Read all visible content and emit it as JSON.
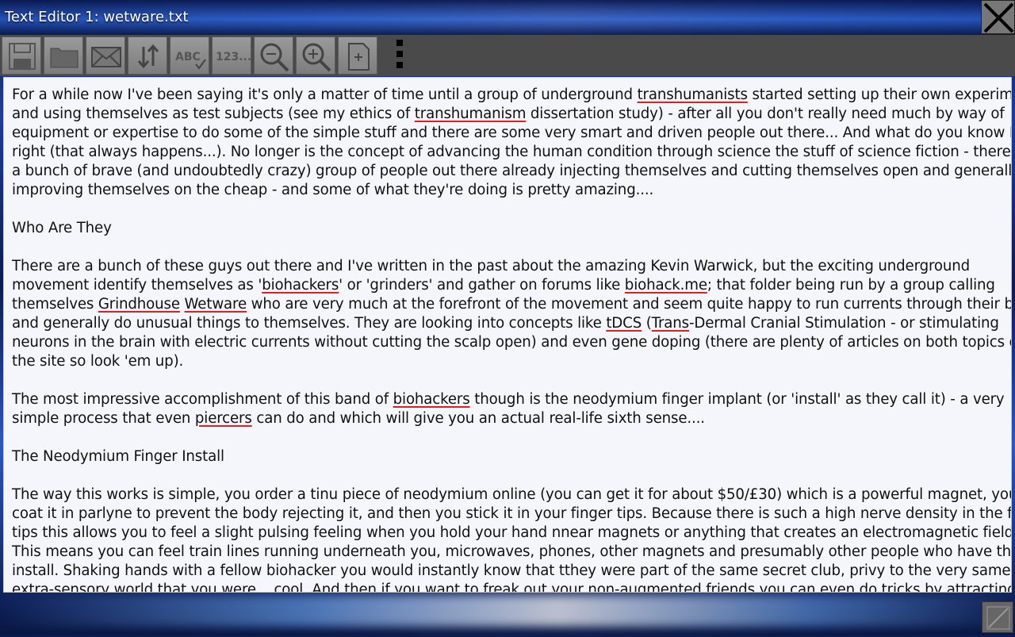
{
  "window": {
    "title": "Text Editor 1: wetware.txt"
  },
  "toolbar": {
    "buttons": [
      {
        "name": "save",
        "icon": "floppy-icon"
      },
      {
        "name": "open",
        "icon": "folder-icon"
      },
      {
        "name": "email",
        "icon": "envelope-icon"
      },
      {
        "name": "sort",
        "icon": "up-down-arrows-icon"
      },
      {
        "name": "spellcheck",
        "icon": "abc-check-icon",
        "label": "ABC"
      },
      {
        "name": "numbers",
        "icon": "123-icon",
        "label": "123..."
      },
      {
        "name": "zoom-out",
        "icon": "zoom-out-icon"
      },
      {
        "name": "zoom-in",
        "icon": "zoom-in-icon"
      },
      {
        "name": "new-document",
        "icon": "new-page-icon"
      }
    ],
    "overflow_icon": "more-vert-icon"
  },
  "document": {
    "lines": [
      "For a while now I've been saying it's only a matter of time until a group of underground |transhumanists| started setting up their own experiments",
      "and using themselves as test subjects (see my ethics of |transhumanism| dissertation study) - after all you don't really need much by way of",
      "equipment or expertise to do some of the simple stuff and there are some very smart and driven people out there... And what do you know I was",
      "right (that always happens...). No longer is the concept of advancing the human condition through science the stuff of science fiction - there are",
      "a bunch of brave (and undoubtedly crazy) group of people out there already injecting themselves and cutting themselves open and generally",
      "improving themselves on the cheap - and some of what they're doing is pretty amazing....",
      "",
      "Who Are They",
      "",
      "There are a bunch of these guys out there and I've written in the past about the amazing Kevin Warwick, but the exciting underground",
      "movement identify themselves as '|biohackers|' or 'grinders' and gather on forums like |biohack.me|; that folder being run by a group calling",
      "themselves |Grindhouse| |Wetware| who are very much at the forefront of the movement and seem quite happy to run currents through their brains",
      "and generally do unusual things to themselves. They are looking into concepts like |tDCS| (|Trans|-Dermal Cranial Stimulation - or stimulating",
      "neurons in the brain with electric currents without cutting the scalp open) and even gene doping (there are plenty of articles on both topics on",
      "the site so look 'em up).",
      "",
      "The most impressive accomplishment of this band of |biohackers| though is the neodymium finger implant (or 'install' as they call it) - a very",
      "simple process that even |piercers| can do and which will give you an actual real-life sixth sense....",
      "",
      "The Neodymium Finger Install",
      "",
      "The way this works is simple, you order a tinu piece of neodymium online (you can get it for about $50/£30) which is a powerful magnet, you",
      "coat it in parlyne to prevent the body rejecting it, and then you stick it in your finger tips. Because there is such a high nerve density in the finger",
      "tips this allows you to feel a slight pulsing feeling when you hold your hand nnear magnets or anything that creates an electromagnetic field.",
      "This means you can feel train lines running underneath you, microwaves, phones, other magnets and presumably other people who have the",
      "install. Shaking hands with a fellow biohacker you would instantly know that tthey were part of the same secret club, privy to the very same",
      "extra-sensory world that you were... cool. And then if you want to freak out your non-augmented friends you can even do tricks by attracting"
    ]
  },
  "colors": {
    "spell_underline": "#e02020",
    "editor_bg": "#f4f6fb",
    "toolbar_bg": "#4a4a4a"
  }
}
